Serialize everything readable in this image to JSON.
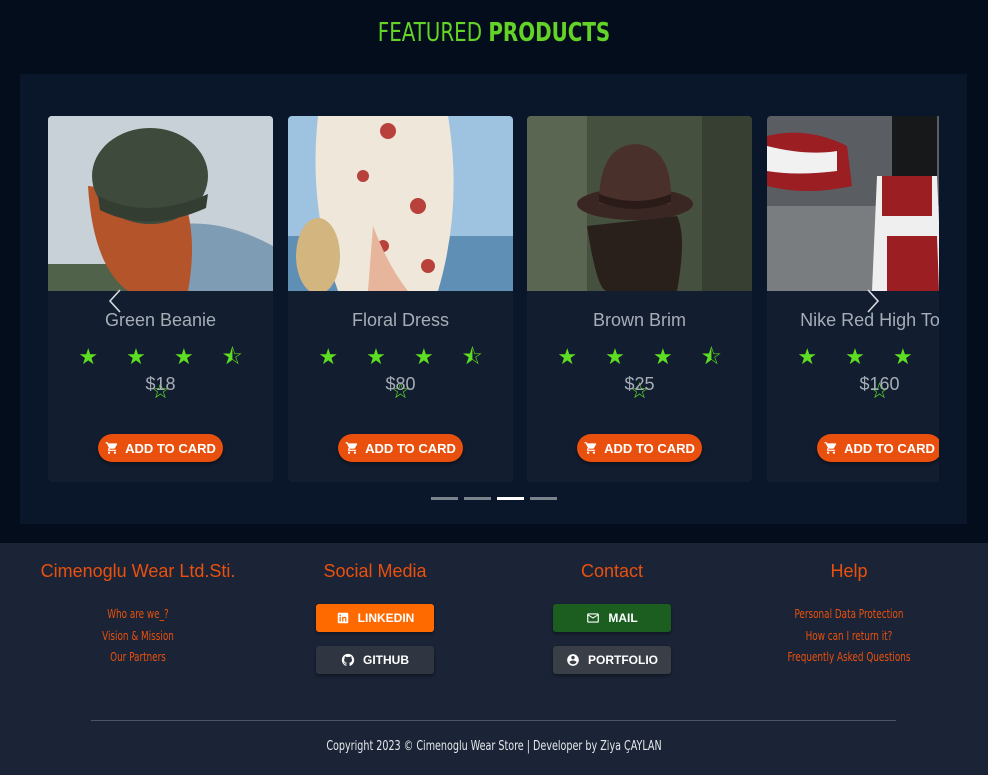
{
  "section": {
    "title_light": "FEATURED",
    "title_bold": "PRODUCTS"
  },
  "products": [
    {
      "name": "Green Beanie",
      "stars": "★ ★ ★ ⯪ ☆",
      "price": "$18",
      "button": "ADD TO CARD"
    },
    {
      "name": "Floral Dress",
      "stars": "★ ★ ★ ⯪ ☆",
      "price": "$80",
      "button": "ADD TO CARD"
    },
    {
      "name": "Brown Brim",
      "stars": "★ ★ ★ ⯪ ☆",
      "price": "$25",
      "button": "ADD TO CARD"
    },
    {
      "name": "Nike Red High Tops",
      "stars": "★ ★ ★ ⯪ ☆",
      "price": "$160",
      "button": "ADD TO CARD"
    }
  ],
  "rating": 3.5,
  "carousel": {
    "slides": 4,
    "active_slide": 3
  },
  "footer": {
    "company": {
      "title": "Cimenoglu Wear Ltd.Sti.",
      "links": [
        "Who are we_?",
        "Vision & Mission",
        "Our Partners"
      ]
    },
    "social": {
      "title": "Social Media",
      "linkedin": "LINKEDIN",
      "github": "GITHUB"
    },
    "contact": {
      "title": "Contact",
      "mail": "MAIL",
      "portfolio": "PORTFOLIO"
    },
    "help": {
      "title": "Help",
      "links": [
        "Personal Data Protection",
        "How can I return it?",
        "Frequently Asked Questions"
      ]
    },
    "copyright": "Copyright 2023 © Cimenoglu Wear Store | Developer by Ziya ÇAYLAN"
  },
  "colors": {
    "accent_green": "#63d427",
    "accent_orange": "#ea500d",
    "linkedin": "#ff6a00",
    "mail": "#1b5e20",
    "dark_button": "#2f3642"
  }
}
